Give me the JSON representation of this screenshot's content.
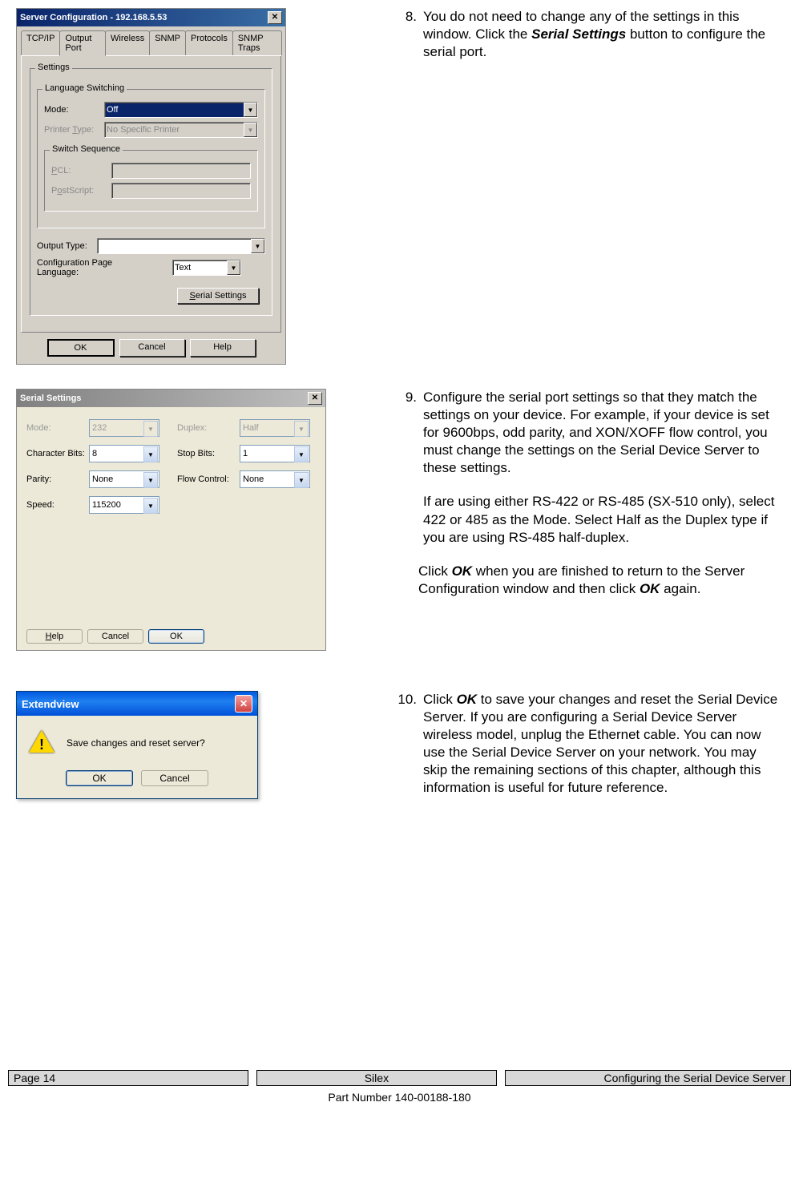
{
  "step8": {
    "num": "8.",
    "text_parts": [
      "You do not need to change any of the settings in this window.  Click the ",
      "Serial Settings",
      " button to configure the serial port."
    ]
  },
  "step9": {
    "num": "9.",
    "p1": "Configure the serial port settings so that they match the settings on your device.  For example, if your device is set for 9600bps, odd parity, and XON/XOFF flow control, you must change the settings on the Serial Device Server to these settings.",
    "p2": "If are using either RS-422 or RS-485 (SX-510 only), select 422 or 485 as the Mode.  Select Half as the Duplex type if you are using RS-485 half-duplex.",
    "p3_parts": [
      "Click ",
      "OK",
      " when you are finished to return to the Server Configuration window and then click ",
      "OK",
      " again."
    ]
  },
  "step10": {
    "num": "10.",
    "text_parts": [
      "Click ",
      "OK",
      " to save your changes and reset the Serial Device Server.  If you are configuring a Serial Device Server wireless model, unplug the Ethernet cable. You can now use the Serial Device Server on your network.  You may skip the remaining sections of this chapter, although this information is useful for future reference."
    ]
  },
  "dialog1": {
    "title": "Server Configuration - 192.168.5.53",
    "tabs": [
      "TCP/IP",
      "Output Port",
      "Wireless",
      "SNMP",
      "Protocols",
      "SNMP Traps"
    ],
    "settings_label": "Settings",
    "lang_switch_label": "Language Switching",
    "mode_label": "Mode:",
    "mode_value": "Off",
    "printer_type_label": "Printer Type:",
    "printer_type_value": "No Specific Printer",
    "switch_seq_label": "Switch Sequence",
    "pcl_label": "PCL:",
    "postscript_label": "PostScript:",
    "output_type_label": "Output Type:",
    "config_lang_label": "Configuration Page Language:",
    "config_lang_value": "Text",
    "serial_btn": "Serial Settings",
    "ok_btn": "OK",
    "cancel_btn": "Cancel",
    "help_btn": "Help"
  },
  "dialog2": {
    "title": "Serial Settings",
    "mode_label": "Mode:",
    "mode_value": "232",
    "char_bits_label": "Character Bits:",
    "char_bits_value": "8",
    "parity_label": "Parity:",
    "parity_value": "None",
    "speed_label": "Speed:",
    "speed_value": "115200",
    "duplex_label": "Duplex:",
    "duplex_value": "Half",
    "stop_bits_label": "Stop Bits:",
    "stop_bits_value": "1",
    "flow_label": "Flow Control:",
    "flow_value": "None",
    "help_btn": "Help",
    "cancel_btn": "Cancel",
    "ok_btn": "OK"
  },
  "dialog3": {
    "title": "Extendview",
    "message": "Save changes and reset server?",
    "ok_btn": "OK",
    "cancel_btn": "Cancel"
  },
  "footer": {
    "page": "Page 14",
    "center": "Silex",
    "right": "Configuring the Serial Device Server",
    "part": "Part Number 140-00188-180"
  }
}
